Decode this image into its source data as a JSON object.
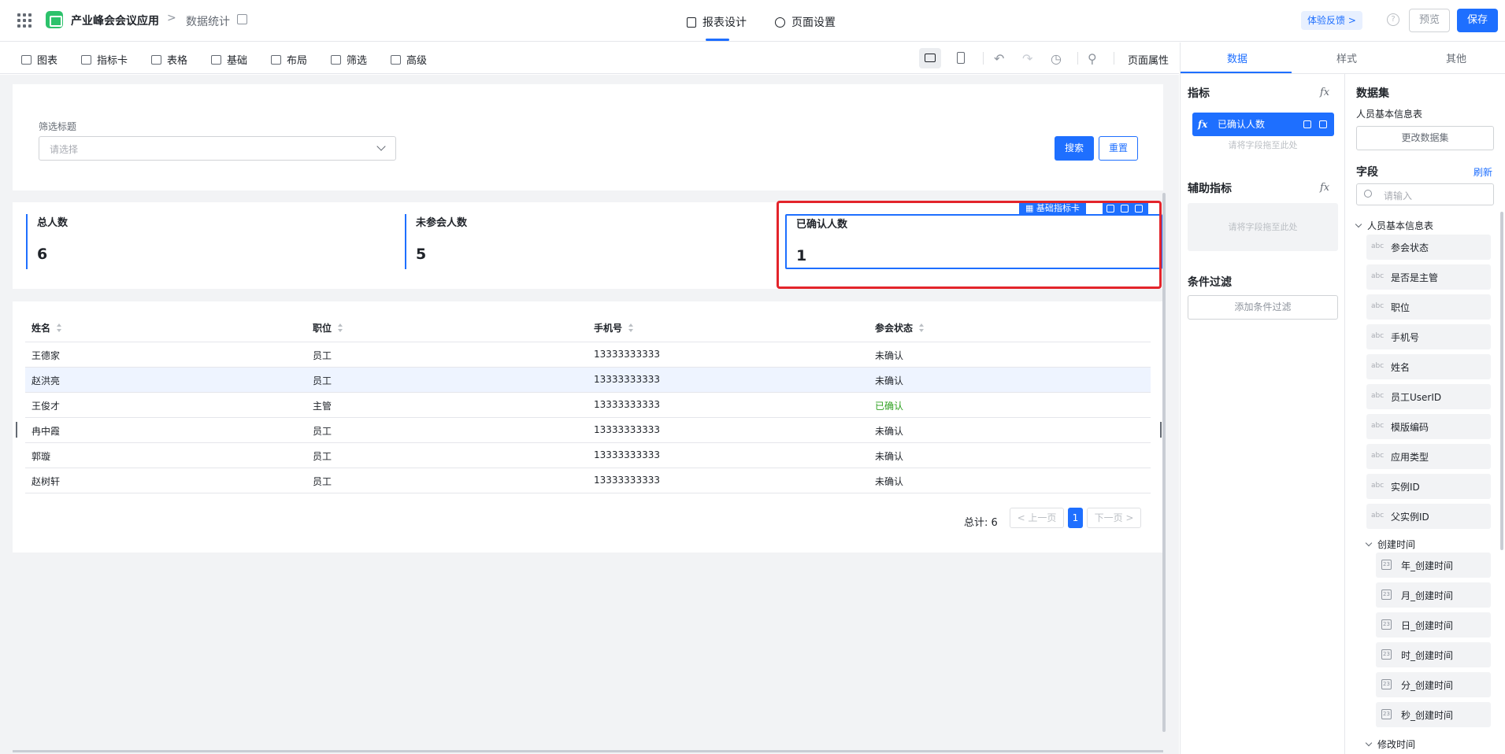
{
  "header": {
    "app_name": "产业峰会会议应用",
    "breadcrumb_sep": ">",
    "page_name": "数据统计",
    "tabs": [
      {
        "label": "报表设计"
      },
      {
        "label": "页面设置"
      }
    ],
    "feedback_label": "体验反馈 >",
    "help_glyph": "?",
    "preview_label": "预览",
    "save_label": "保存"
  },
  "toolbar": {
    "items": [
      {
        "label": "图表",
        "icon": "bar-chart-icon"
      },
      {
        "label": "指标卡",
        "icon": "number-card-icon"
      },
      {
        "label": "表格",
        "icon": "table-icon"
      },
      {
        "label": "基础",
        "icon": "grid-icon"
      },
      {
        "label": "布局",
        "icon": "layout-icon"
      },
      {
        "label": "筛选",
        "icon": "funnel-icon"
      },
      {
        "label": "高级",
        "icon": "layers-icon"
      }
    ],
    "undo_glyph": "↶",
    "redo_glyph": "↷",
    "history_glyph": "◷",
    "search_glyph": "⚲",
    "page_props_label": "页面属性"
  },
  "filter": {
    "label": "筛选标题",
    "placeholder": "请选择",
    "search_label": "搜索",
    "reset_label": "重置"
  },
  "kpis": [
    {
      "title": "总人数",
      "value": "6"
    },
    {
      "title": "未参会人数",
      "value": "5"
    },
    {
      "title": "已确认人数",
      "value": "1"
    }
  ],
  "kpi_selection_tag": "基础指标卡",
  "table": {
    "columns": [
      "姓名",
      "职位",
      "手机号",
      "参会状态"
    ],
    "rows": [
      [
        "王德家",
        "员工",
        "13333333333",
        "未确认"
      ],
      [
        "赵洪亮",
        "员工",
        "13333333333",
        "未确认"
      ],
      [
        "王俊才",
        "主管",
        "13333333333",
        "已确认"
      ],
      [
        "冉中霞",
        "员工",
        "13333333333",
        "未确认"
      ],
      [
        "郭璇",
        "员工",
        "13333333333",
        "未确认"
      ],
      [
        "赵树轩",
        "员工",
        "13333333333",
        "未确认"
      ]
    ]
  },
  "pagination": {
    "total_label": "总计: 6",
    "prev_label": "< 上一页",
    "current_page": "1",
    "next_label": "下一页 >"
  },
  "panel": {
    "tabs": [
      "数据",
      "样式",
      "其他"
    ],
    "metrics_title": "指标",
    "fx_glyph": "fx",
    "metric_chip": "已确认人数",
    "drop_hint": "请将字段拖至此处",
    "aux_title": "辅助指标",
    "condition_title": "条件过滤",
    "add_filter_label": "添加条件过滤",
    "dataset_title": "数据集",
    "dataset_name": "人员基本信息表",
    "change_dataset_label": "更改数据集",
    "fields_title": "字段",
    "refresh_label": "刷新",
    "field_search_placeholder": "请输入",
    "tree_root": "人员基本信息表",
    "abc_tag": "abc",
    "date_tag": "23",
    "fields": [
      "参会状态",
      "是否是主管",
      "职位",
      "手机号",
      "姓名",
      "员工UserID",
      "模版编码",
      "应用类型",
      "实例ID",
      "父实例ID"
    ],
    "created_group": "创建时间",
    "created_fields": [
      "年_创建时间",
      "月_创建时间",
      "日_创建时间",
      "时_创建时间",
      "分_创建时间",
      "秒_创建时间"
    ],
    "modified_group": "修改时间"
  },
  "colors": {
    "accent": "#1e6fff",
    "confirmed": "#2ea121",
    "highlight": "#e3242b"
  }
}
